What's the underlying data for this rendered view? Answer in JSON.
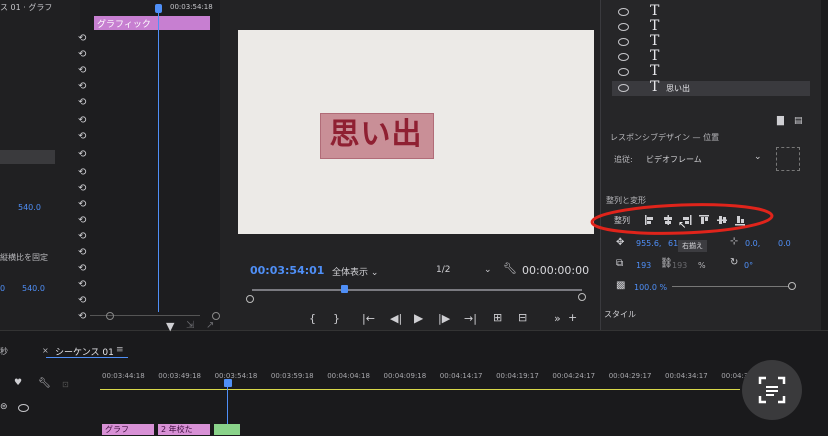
{
  "left_panel": {
    "tab_title": "ス 01 · グラフ",
    "value_540_top": "540.0",
    "value_540_bottom": "540.0",
    "value_0": "0",
    "lock_ratio_label": "縦横比を固定"
  },
  "mid_panel": {
    "clip_label": "グラフィック",
    "timecode_top": "00:03:54:18"
  },
  "program": {
    "title_text": "思い出",
    "current_time": "00:03:54:01",
    "zoom_select": "全体表示",
    "resolution_select": "1/2",
    "duration": "00:00:00:00"
  },
  "right_panel": {
    "layer_name": "思い出",
    "responsive_label": "レスポンシブデザイン — 位置",
    "follow_label": "追従:",
    "follow_value": "ビデオフレーム",
    "align_transform_label": "整列と変形",
    "align_label": "整列",
    "tooltip": "右揃え",
    "pos_x": "955.6,",
    "pos_y": "61",
    "anchor_x": "0.0,",
    "anchor_y": "0.0",
    "scale_w": "193",
    "scale_h": "193",
    "scale_unit": "%",
    "rotation": "0°",
    "opacity": "100.0 %",
    "style_label": "スタイル"
  },
  "timeline": {
    "left_label": "秒",
    "close_x": "×",
    "sequence_tab": "シーケンス 01",
    "menu_icon": "≡",
    "ruler": [
      "00:03:44:18",
      "00:03:49:18",
      "00:03:54:18",
      "00:03:59:18",
      "00:04:04:18",
      "00:04:09:18",
      "00:04:14:17",
      "00:04:19:17",
      "00:04:24:17",
      "00:04:29:17",
      "00:04:34:17",
      "00:04:39:17"
    ],
    "clip1": "グラフ",
    "clip2": "2 年校た"
  },
  "colors": {
    "accent_blue": "#4f8ff7",
    "title_pink": "#c98f97",
    "clip_pink": "#d891d6",
    "annotation_red": "#e0241b"
  }
}
